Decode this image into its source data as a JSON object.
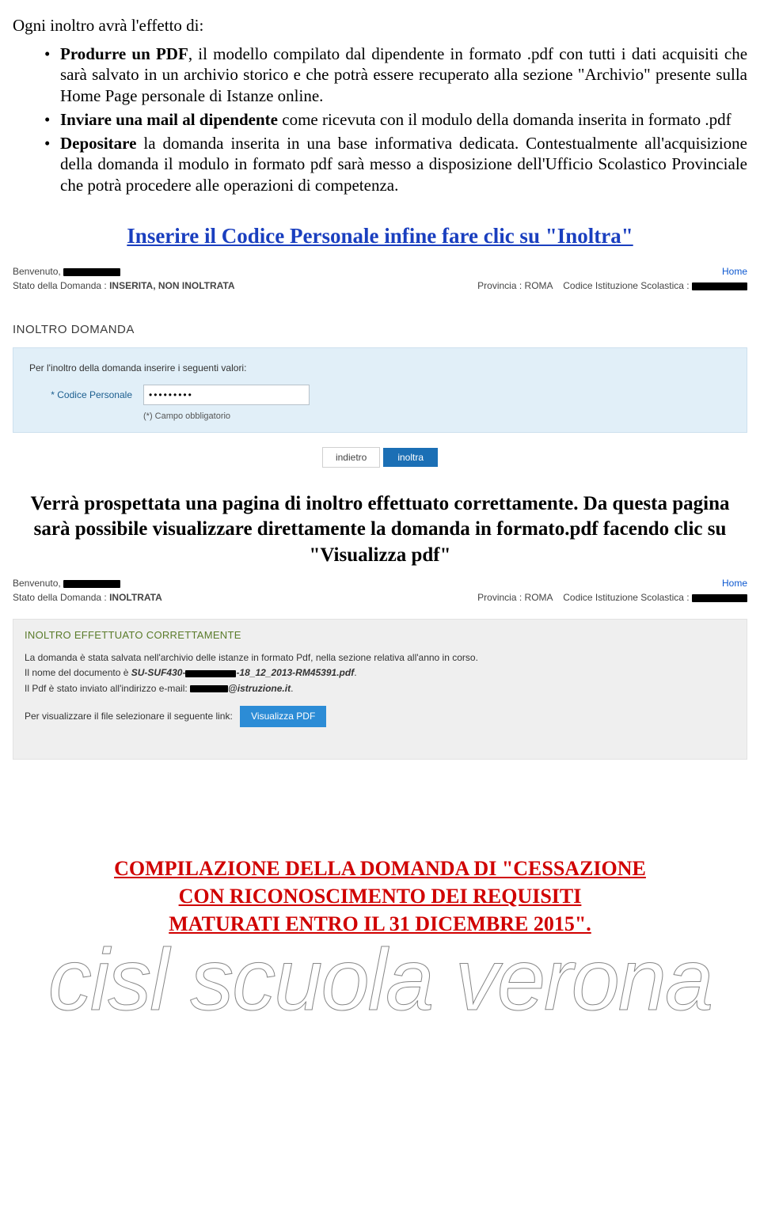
{
  "intro": "Ogni inoltro avrà l'effetto di:",
  "bullets": {
    "b1_a": "Produrre un PDF",
    "b1_b": ", il modello compilato dal dipendente in formato .pdf con tutti i dati acquisiti che sarà salvato in un archivio storico e che potrà essere recuperato alla sezione \"Archivio\" presente sulla Home Page personale di Istanze online.",
    "b2_a": "Inviare una mail al dipendente ",
    "b2_b": "come ricevuta con il modulo della domanda inserita in formato .pdf",
    "b3_a": "Depositare ",
    "b3_b": "la domanda inserita in una base informativa dedicata. Contestualmente all'acquisizione della domanda il modulo in formato pdf sarà messo a disposizione dell'Ufficio Scolastico Provinciale che potrà procedere alle operazioni di competenza."
  },
  "heading_blue": "Inserire il Codice Personale infine fare clic su \"Inoltra\"",
  "shot1": {
    "benvenuto": "Benvenuto,",
    "home": "Home",
    "state_label": "Stato della Domanda :",
    "state_value": "INSERITA, NON INOLTRATA",
    "prov_label": "Provincia :",
    "prov_value": "ROMA",
    "cod_label": "Codice Istituzione Scolastica :",
    "title": "INOLTRO DOMANDA",
    "panel_intro": "Per l'inoltro della domanda inserire i seguenti valori:",
    "field_label": "* Codice Personale",
    "field_value": "•••••••••",
    "note": "(*) Campo obbligatorio",
    "back": "indietro",
    "forward": "inoltra"
  },
  "black_block": "Verrà prospettata una pagina di inoltro effettuato correttamente. Da questa pagina sarà possibile visualizzare direttamente la domanda in formato.pdf facendo clic su \"Visualizza pdf\"",
  "shot2": {
    "benvenuto": "Benvenuto,",
    "home": "Home",
    "state_label": "Stato della Domanda :",
    "state_value": "INOLTRATA",
    "prov_label": "Provincia :",
    "prov_value": "ROMA",
    "cod_label": "Codice Istituzione Scolastica :",
    "green_title": "INOLTRO EFFETTUATO CORRETTAMENTE",
    "line1": "La domanda è stata salvata nell'archivio delle istanze in formato Pdf, nella sezione relativa all'anno in corso.",
    "line2a": "Il nome del documento è ",
    "line2b": "SU-SUF430-",
    "line2c": "-18_12_2013-RM45391.pdf",
    "line3a": "Il Pdf è stato inviato all'indirizzo e-mail: ",
    "line3b": "@istruzione.it",
    "line4": "Per visualizzare il file selezionare il seguente link:",
    "btn": "Visualizza PDF"
  },
  "red_block_l1": "COMPILAZIONE DELLA DOMANDA DI \"CESSAZIONE",
  "red_block_l2": "CON RICONOSCIMENTO DEI REQUISITI",
  "red_block_l3": "MATURATI ENTRO IL 31 DICEMBRE 2015\".",
  "watermark": "cisl scuola verona"
}
